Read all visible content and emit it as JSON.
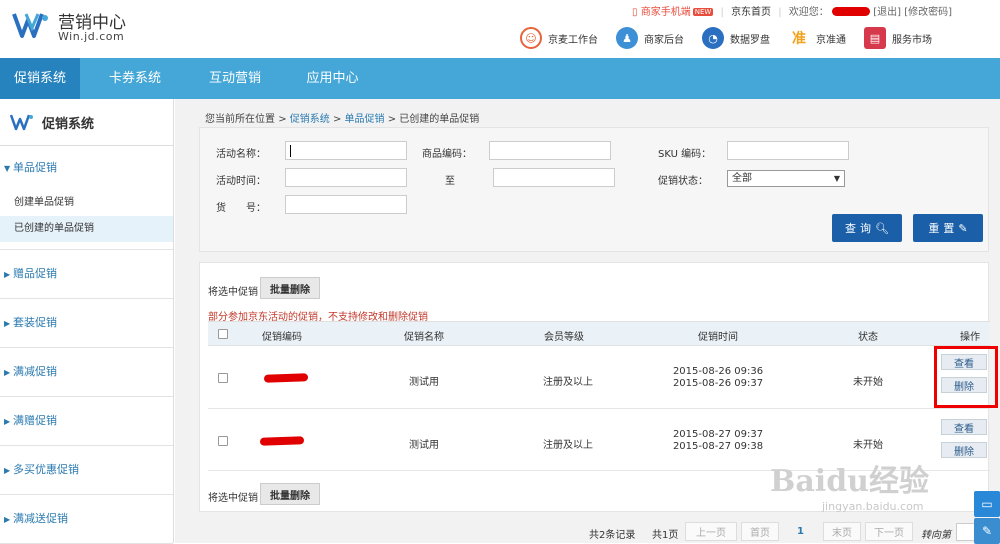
{
  "header": {
    "logo_title": "营销中心",
    "logo_sub": "Win.jd.com",
    "mobile": "商家手机端",
    "new_tag": "NEW",
    "jd_home": "京东首页",
    "welcome": "欢迎您：",
    "logout": "[退出]",
    "change_pwd": "[修改密码]"
  },
  "apps": [
    {
      "label": "京麦工作台",
      "icon": "chat-bubble-icon",
      "color": "#e8633c"
    },
    {
      "label": "商家后台",
      "icon": "users-icon",
      "color": "#3d8fd6"
    },
    {
      "label": "数据罗盘",
      "icon": "compass-icon",
      "color": "#2a6fc0"
    },
    {
      "label": "京准通",
      "icon": "target-icon",
      "color": "#f2a21c"
    },
    {
      "label": "服务市场",
      "icon": "shop-icon",
      "color": "#d6394b"
    }
  ],
  "nav": [
    "促销系统",
    "卡券系统",
    "互动营销",
    "应用中心"
  ],
  "sidebar": {
    "title": "促销系统",
    "groups": [
      {
        "label": "单品促销",
        "open": true,
        "items": [
          "创建单品促销",
          "已创建的单品促销"
        ]
      },
      {
        "label": "赠品促销"
      },
      {
        "label": "套装促销"
      },
      {
        "label": "满减促销"
      },
      {
        "label": "满赠促销"
      },
      {
        "label": "多买优惠促销"
      },
      {
        "label": "满减送促销"
      }
    ]
  },
  "breadcrumb": {
    "prefix": "您当前所在位置",
    "items": [
      "促销系统",
      "单品促销",
      "已创建的单品促销"
    ]
  },
  "search": {
    "name_label": "活动名称：",
    "sku_code_label": "商品编码：",
    "sku_label": "SKU 编码：",
    "time_label": "活动时间：",
    "to_label": "至",
    "status_label": "促销状态：",
    "status_value": "全部",
    "item_no_label": "货　　号：",
    "search_btn": "查询",
    "reset_btn": "重置"
  },
  "list": {
    "select_label": "将选中促销",
    "batch_delete": "批量删除",
    "warning": "部分参加京东活动的促销，不支持修改和删除促销",
    "columns": [
      "促销编码",
      "促销名称",
      "会员等级",
      "促销时间",
      "状态",
      "操作"
    ],
    "rows": [
      {
        "name": "测试用",
        "level": "注册及以上",
        "start": "2015-08-26 09:36",
        "end": "2015-08-26 09:37",
        "status": "未开始",
        "view": "查看",
        "delete": "删除"
      },
      {
        "name": "测试用",
        "level": "注册及以上",
        "start": "2015-08-27 09:37",
        "end": "2015-08-27 09:38",
        "status": "未开始",
        "view": "查看",
        "delete": "删除"
      }
    ]
  },
  "pager": {
    "total": "共2条记录",
    "pages": "共1页",
    "prev": "上一页",
    "first": "首页",
    "current": "1",
    "last": "末页",
    "next": "下一页",
    "goto": "转向第"
  },
  "watermark": {
    "text": "Baidu经验",
    "url": "jingyan.baidu.com"
  }
}
